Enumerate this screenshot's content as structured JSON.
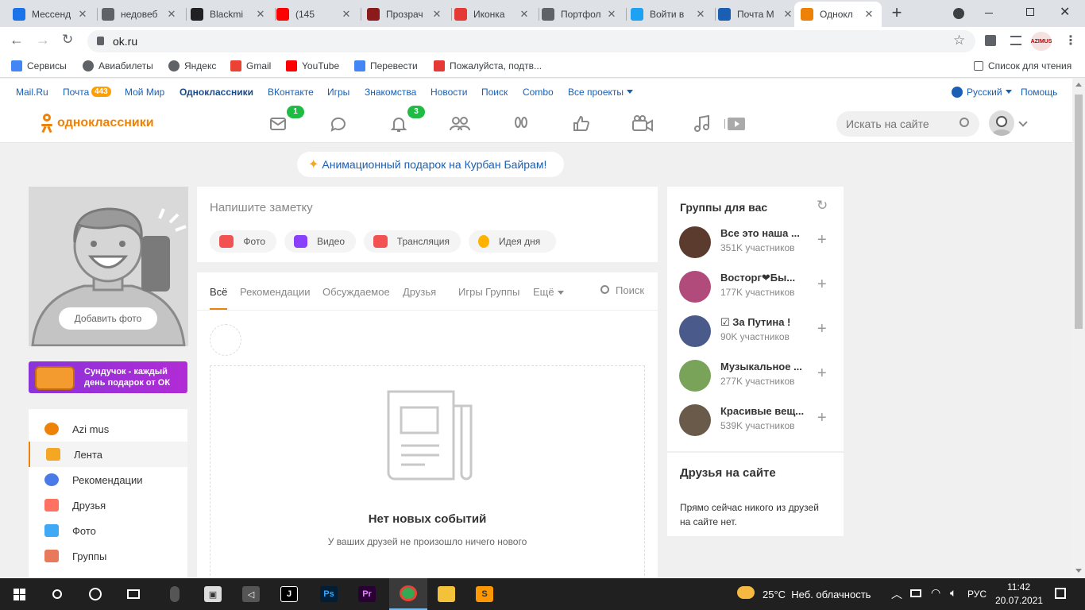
{
  "browser": {
    "tabs": [
      {
        "title": "Мессенд",
        "icon": "messenger-icon",
        "color": "#1a73e8"
      },
      {
        "title": "недовеб",
        "icon": "globe-icon",
        "color": "#5f6368"
      },
      {
        "title": "Blackmi",
        "icon": "blackmi-icon",
        "color": "#202124"
      },
      {
        "title": "(145",
        "icon": "youtube-icon",
        "color": "#ff0000"
      },
      {
        "title": "Прозрач",
        "icon": "opera-icon",
        "color": "#8b1a1a"
      },
      {
        "title": "Иконка",
        "icon": "icon-site-icon",
        "color": "#e53935"
      },
      {
        "title": "Портфол",
        "icon": "globe-icon",
        "color": "#5f6368"
      },
      {
        "title": "Войти в",
        "icon": "twitter-icon",
        "color": "#1da1f2"
      },
      {
        "title": "Почта M",
        "icon": "mail-icon",
        "color": "#1a5fb4"
      },
      {
        "title": "Однокл",
        "icon": "ok-icon",
        "color": "#ee8208"
      }
    ],
    "url": "ok.ru",
    "extension_label": "AZIMUS",
    "bookmarks": [
      {
        "label": "Сервисы",
        "color": "#4285f4"
      },
      {
        "label": "Авиабилеты",
        "color": "#5f6368"
      },
      {
        "label": "Яндекс",
        "color": "#5f6368"
      },
      {
        "label": "Gmail",
        "color": "#ea4335"
      },
      {
        "label": "YouTube",
        "color": "#ff0000"
      },
      {
        "label": "Перевести",
        "color": "#4285f4"
      },
      {
        "label": "Пожалуйста, подтв...",
        "color": "#e53935"
      }
    ],
    "reading_list": "Список для чтения"
  },
  "portal": {
    "links": [
      "Mail.Ru",
      "Почта",
      "Мой Мир",
      "Одноклассники",
      "ВКонтакте",
      "Игры",
      "Знакомства",
      "Новости",
      "Поиск",
      "Combo",
      "Все проекты"
    ],
    "mail_count": "443",
    "language": "Русский",
    "help": "Помощь"
  },
  "header": {
    "logo": "одноклассники",
    "messages_badge": "1",
    "notifications_badge": "3",
    "search_placeholder": "Искать на сайте"
  },
  "promo": "Анимационный подарок на Курбан Байрам!",
  "profile": {
    "add_photo": "Добавить фото",
    "chest_banner": "Сундучок - каждый день подарок от ОК"
  },
  "menu": [
    "Azi mus",
    "Лента",
    "Рекомендации",
    "Друзья",
    "Фото",
    "Группы"
  ],
  "note": {
    "placeholder": "Напишите заметку",
    "actions": [
      "Фото",
      "Видео",
      "Трансляция",
      "Идея дня"
    ]
  },
  "feed": {
    "tabs": [
      "Всё",
      "Рекомендации",
      "Обсуждаемое",
      "Друзья",
      "Игры",
      "Группы",
      "Ещё"
    ],
    "search": "Поиск",
    "empty_title": "Нет новых событий",
    "empty_sub": "У ваших друзей не произошло ничего нового"
  },
  "groups": {
    "title": "Группы для вас",
    "items": [
      {
        "name": "Все это наша ...",
        "members": "351K участников"
      },
      {
        "name": "Восторг❤Бы...",
        "members": "177K участников"
      },
      {
        "name": "☑ За Путина !",
        "members": "90K участников"
      },
      {
        "name": "Музыкальное ...",
        "members": "277K участников"
      },
      {
        "name": "Красивые вещ...",
        "members": "539K участников"
      }
    ]
  },
  "friends_online": {
    "title": "Друзья на сайте",
    "text": "Прямо сейчас никого из друзей на сайте нет."
  },
  "taskbar": {
    "weather": "25°C  Неб. облачность",
    "lang": "РУС",
    "time": "11:42",
    "date": "20.07.2021"
  }
}
